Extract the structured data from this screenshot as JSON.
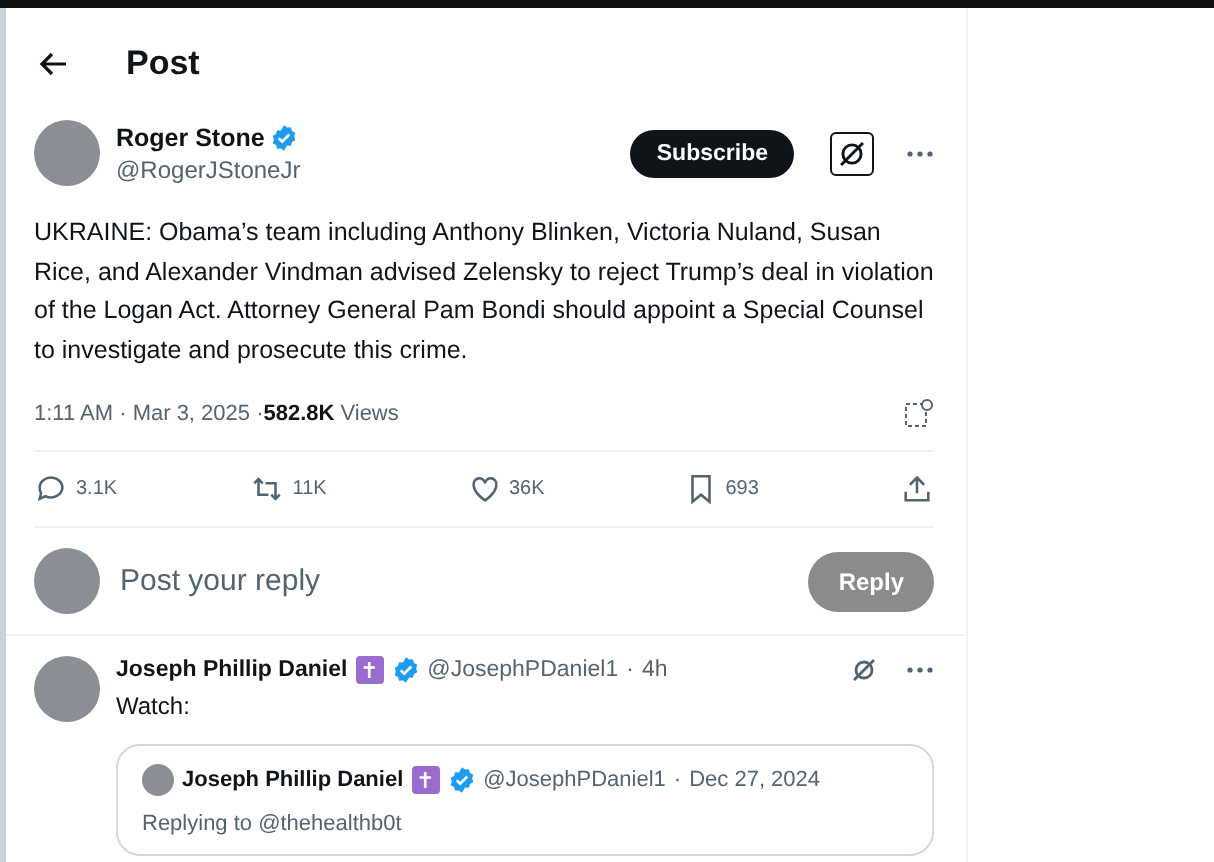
{
  "header": {
    "title": "Post"
  },
  "post": {
    "author": {
      "name": "Roger Stone",
      "verified": true,
      "handle": "@RogerJStoneJr"
    },
    "subscribe_label": "Subscribe",
    "text": "UKRAINE: Obama’s team including Anthony Blinken, Victoria Nuland, Susan Rice, and Alexander Vindman advised Zelensky to reject Trump’s deal in violation of the Logan Act. Attorney General Pam Bondi should appoint a Special Counsel to investigate and prosecute this crime.",
    "time": "1:11 AM · Mar 3, 2025 · ",
    "views_count": "582.8K",
    "views_label": "Views",
    "actions": [
      {
        "kind": "reply",
        "count": "3.1K"
      },
      {
        "kind": "repost",
        "count": "11K"
      },
      {
        "kind": "like",
        "count": "36K"
      },
      {
        "kind": "bookmark",
        "count": "693"
      },
      {
        "kind": "share"
      }
    ]
  },
  "composer": {
    "placeholder": "Post your reply",
    "button": "Reply",
    "disabled": true
  },
  "replies": [
    {
      "name": "Joseph Phillip Daniel",
      "badge": "✝",
      "verified": true,
      "handle": "@JosephPDaniel1",
      "separator": "·",
      "time": "4h",
      "text": "Watch:",
      "quote": {
        "name": "Joseph Phillip Daniel",
        "badge": "✝",
        "verified": true,
        "handle": "@JosephPDaniel1",
        "separator": "·",
        "time": "Dec 27, 2024",
        "replying_to": "Replying to @thehealthb0t"
      }
    }
  ]
}
